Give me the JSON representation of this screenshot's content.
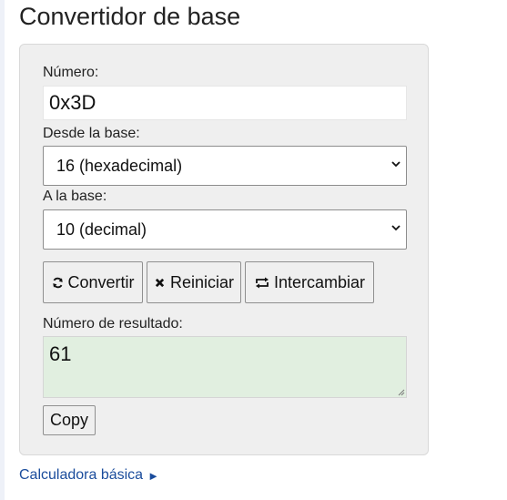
{
  "page": {
    "title": "Convertidor de base"
  },
  "form": {
    "number_label": "Número:",
    "number_value": "0x3D",
    "from_label": "Desde la base:",
    "from_value": "16 (hexadecimal)",
    "to_label": "A la base:",
    "to_value": "10 (decimal)",
    "result_label": "Número de resultado:",
    "result_value": "61"
  },
  "buttons": {
    "convert": {
      "label": "Convertir",
      "icon": "refresh-icon"
    },
    "reset": {
      "label": "Reiniciar",
      "icon": "close-icon"
    },
    "swap": {
      "label": "Intercambiar",
      "icon": "swap-icon"
    },
    "copy": {
      "label": "Copy"
    }
  },
  "footer": {
    "link_label": "Calculadora básica",
    "link_arrow": "►"
  },
  "colors": {
    "panel_bg": "#efefef",
    "result_bg": "#e1efe0",
    "link": "#1a4c9c"
  }
}
